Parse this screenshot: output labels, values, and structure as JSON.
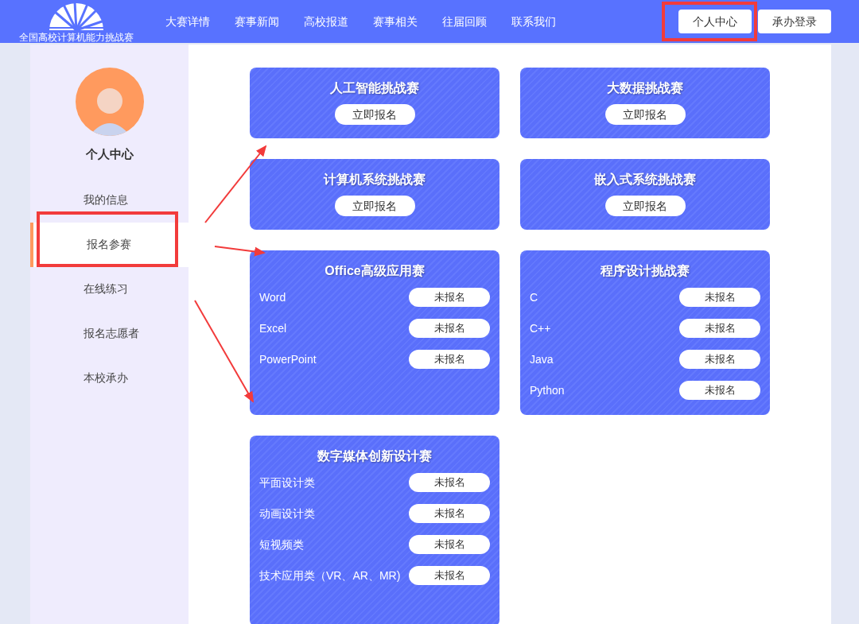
{
  "header": {
    "logo_text": "全国高校计算机能力挑战赛",
    "nav": [
      "大赛详情",
      "赛事新闻",
      "高校报道",
      "赛事相关",
      "往届回顾",
      "联系我们"
    ],
    "buttons": [
      "个人中心",
      "承办登录"
    ]
  },
  "sidebar": {
    "title": "个人中心",
    "items": [
      {
        "label": "我的信息",
        "selected": false
      },
      {
        "label": "报名参赛",
        "selected": true
      },
      {
        "label": "在线练习",
        "selected": false
      },
      {
        "label": "报名志愿者",
        "selected": false
      },
      {
        "label": "本校承办",
        "selected": false
      }
    ]
  },
  "competitions": [
    {
      "kind": "simple",
      "title": "人工智能挑战赛",
      "button": "立即报名"
    },
    {
      "kind": "simple",
      "title": "大数据挑战赛",
      "button": "立即报名"
    },
    {
      "kind": "simple",
      "title": "计算机系统挑战赛",
      "button": "立即报名"
    },
    {
      "kind": "simple",
      "title": "嵌入式系统挑战赛",
      "button": "立即报名"
    },
    {
      "kind": "list",
      "title": "Office高级应用赛",
      "entries": [
        {
          "name": "Word",
          "status": "未报名"
        },
        {
          "name": "Excel",
          "status": "未报名"
        },
        {
          "name": "PowerPoint",
          "status": "未报名"
        }
      ]
    },
    {
      "kind": "list",
      "title": "程序设计挑战赛",
      "entries": [
        {
          "name": "C",
          "status": "未报名"
        },
        {
          "name": "C++",
          "status": "未报名"
        },
        {
          "name": "Java",
          "status": "未报名"
        },
        {
          "name": "Python",
          "status": "未报名"
        }
      ]
    },
    {
      "kind": "list",
      "title": "数字媒体创新设计赛",
      "entries": [
        {
          "name": "平面设计类",
          "status": "未报名"
        },
        {
          "name": "动画设计类",
          "status": "未报名"
        },
        {
          "name": "短视频类",
          "status": "未报名"
        },
        {
          "name": "技术应用类（VR、AR、MR)",
          "status": "未报名"
        }
      ]
    }
  ]
}
